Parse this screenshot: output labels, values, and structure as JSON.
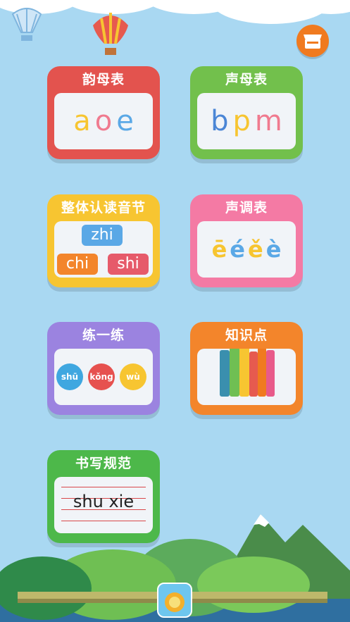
{
  "colors": {
    "background": "#a9d8f2",
    "red": "#e3534e",
    "green": "#72c04c",
    "yellow": "#f7c531",
    "pink": "#f47aa4",
    "purple": "#9b83e0",
    "orange": "#f3852b",
    "darkgreen": "#4db84a"
  },
  "header": {
    "store_icon": "store-icon"
  },
  "cards": {
    "yunmu": {
      "title": "韵母表",
      "letters": [
        "a",
        "o",
        "e"
      ]
    },
    "shengmu": {
      "title": "声母表",
      "letters": [
        "b",
        "p",
        "m"
      ]
    },
    "zhengti": {
      "title": "整体认读音节",
      "syllables": [
        "zhi",
        "chi",
        "shi"
      ]
    },
    "shengdiao": {
      "title": "声调表",
      "tones": [
        "ē",
        "é",
        "ě",
        "è"
      ]
    },
    "lianyilian": {
      "title": "练一练",
      "words": [
        "shū",
        "kǒng",
        "wù"
      ]
    },
    "zhishidian": {
      "title": "知识点",
      "icon": "books-icon"
    },
    "shuxie": {
      "title": "书写规范",
      "sample": "shu xie"
    }
  },
  "footer": {
    "app_icon": "lion-math-icon"
  }
}
